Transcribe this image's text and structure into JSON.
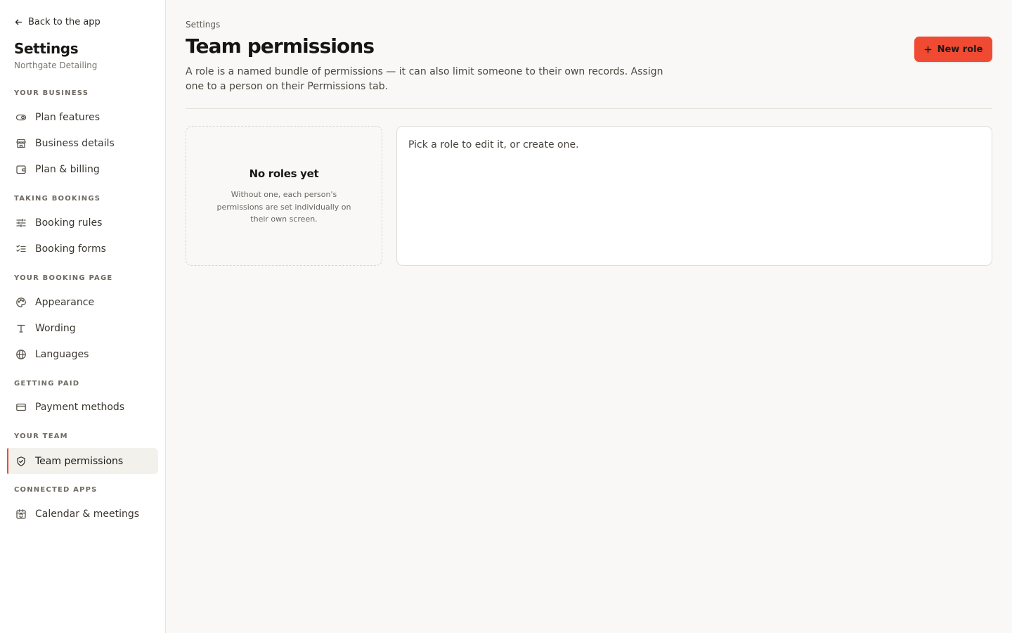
{
  "sidebar": {
    "back_label": "Back to the app",
    "title": "Settings",
    "business_name": "Northgate Detailing",
    "sections": {
      "your_business": "YOUR BUSINESS",
      "taking_bookings": "TAKING BOOKINGS",
      "your_booking_page": "YOUR BOOKING PAGE",
      "getting_paid": "GETTING PAID",
      "your_team": "YOUR TEAM",
      "connected_apps": "CONNECTED APPS"
    },
    "items": {
      "plan_features": "Plan features",
      "business_details": "Business details",
      "plan_billing": "Plan & billing",
      "booking_rules": "Booking rules",
      "booking_forms": "Booking forms",
      "appearance": "Appearance",
      "wording": "Wording",
      "languages": "Languages",
      "payment_methods": "Payment methods",
      "team_permissions": "Team permissions",
      "calendar_meetings": "Calendar & meetings"
    },
    "active_item": "team_permissions"
  },
  "main": {
    "breadcrumb": "Settings",
    "title": "Team permissions",
    "description": "A role is a named bundle of permissions — it can also limit someone to their own records. Assign one to a person on their Permissions tab.",
    "new_role_label": "New role",
    "empty_state": {
      "title": "No roles yet",
      "text": "Without one, each person's permissions are set individually on their own screen."
    },
    "detail_placeholder": "Pick a role to edit it, or create one."
  },
  "colors": {
    "accent": "#f04a32",
    "background": "#f9f8f6",
    "sidebar_bg": "#ffffff",
    "active_item_bg": "#f3f1ec"
  },
  "icons": {
    "back": "arrow-left-icon",
    "plan_features": "toggle-icon",
    "business_details": "storefront-icon",
    "plan_billing": "wallet-icon",
    "booking_rules": "sliders-icon",
    "booking_forms": "checklist-icon",
    "appearance": "palette-icon",
    "wording": "type-icon",
    "languages": "globe-icon",
    "payment_methods": "credit-card-icon",
    "team_permissions": "shield-check-icon",
    "calendar_meetings": "calendar-sync-icon",
    "new_role": "plus-icon"
  }
}
